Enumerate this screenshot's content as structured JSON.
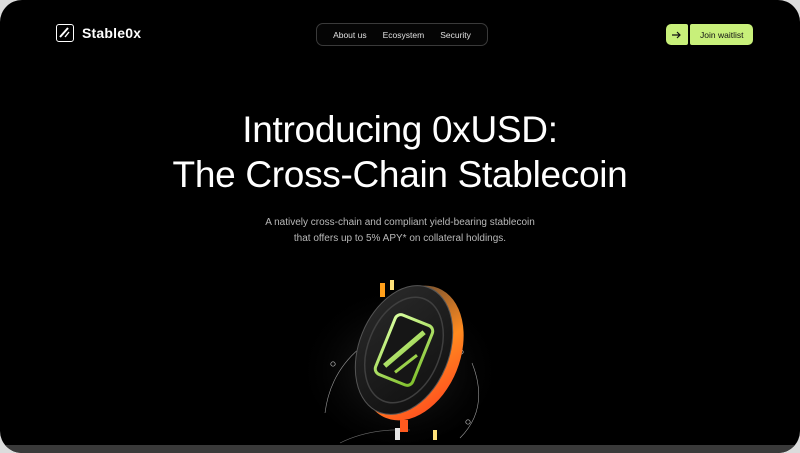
{
  "brand": {
    "name": "Stable0x",
    "logo_icon": "stable0x-logo-icon"
  },
  "nav": {
    "items": [
      {
        "label": "About us"
      },
      {
        "label": "Ecosystem"
      },
      {
        "label": "Security"
      }
    ]
  },
  "cta": {
    "icon": "arrow-right-icon",
    "label": "Join waitlist",
    "accent": "#c8f07a"
  },
  "hero": {
    "title_line1": "Introducing 0xUSD:",
    "title_line2": "The Cross-Chain Stablecoin",
    "subtitle_line1": "A natively cross-chain and compliant yield-bearing stablecoin",
    "subtitle_line2": "that offers up to 5% APY* on collateral holdings.",
    "illustration": "coin-illustration"
  },
  "colors": {
    "background": "#000000",
    "accent": "#c8f07a",
    "coin_glow": "#ff5a1f"
  }
}
